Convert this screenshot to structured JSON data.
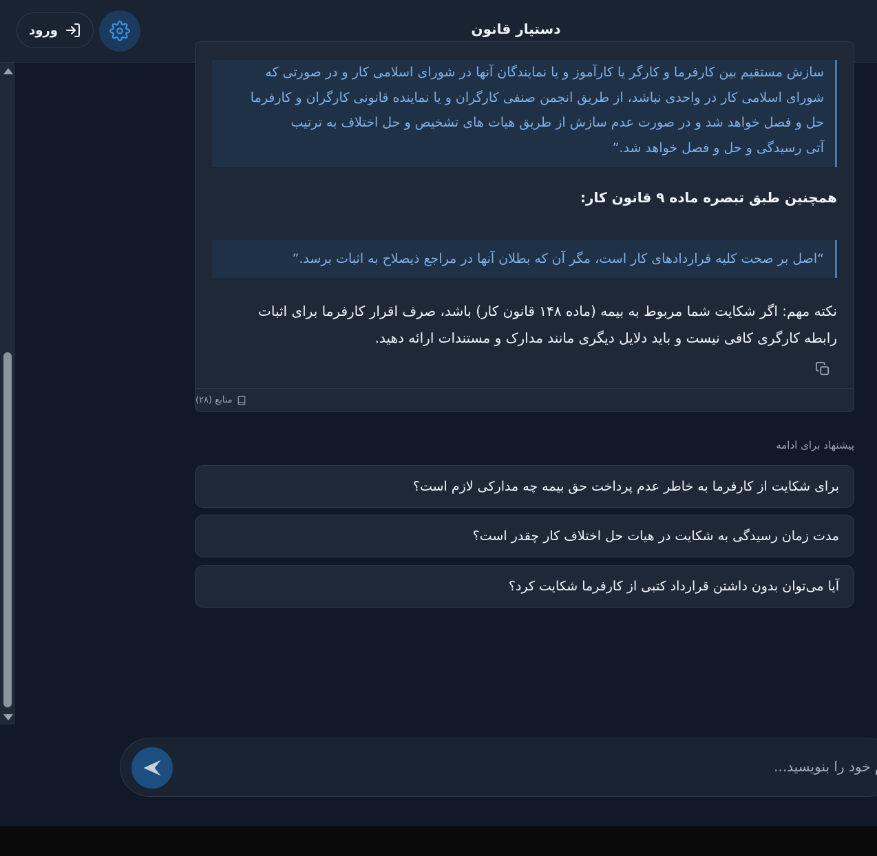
{
  "header": {
    "title": "دستیار قانون",
    "login_label": "ورود",
    "login_icon": "login-arrow-icon",
    "settings_icon": "gear-icon"
  },
  "message": {
    "quote1_lines": [
      "سازش مستقیم بین کارفرما و کارگر یا کارآموز و یا نمایندگان آنها در شورای اسلامی کار و در صورتی که",
      "شورای اسلامی کار در واحدی نباشد، از طریق انجمن صنفی کارگران و یا نماینده قانونی کارگران و کارفرما",
      "حل و فصل خواهد شد و در صورت عدم سازش از طریق هیات های تشخیص و حل اختلاف به ترتیب",
      "آتی رسیدگی و حل و فصل خواهد شد.”"
    ],
    "heading2": "همچنین طبق تبصره ماده ۹ قانون کار:",
    "quote2": "“اصل بر صحت کلیه قراردادهای کار است، مگر آن که بطلان آنها در مراجع ذیصلاح به اثبات برسد.”",
    "note_line1": "نکته مهم: اگر شکایت شما مربوط به بیمه (ماده ۱۴۸ قانون کار) باشد، صرف اقرار کارفرما برای اثبات",
    "note_line2": "رابطه کارگری کافی نیست و باید دلایل دیگری مانند مدارک و مستندات ارائه دهید.",
    "sources_label": "منابع (۲۸)"
  },
  "suggestions": {
    "label": "پیشنهاد برای ادامه",
    "items": [
      "برای شکایت از کارفرما به خاطر عدم پرداخت حق بیمه چه مدارکی لازم است؟",
      "مدت زمان رسیدگی به شکایت در هیات حل اختلاف کار چقدر است؟",
      "آیا می‌توان بدون داشتن قرارداد کتبی از کارفرما شکایت کرد؟"
    ]
  },
  "composer": {
    "placeholder": "پیام خود را بنویسید..."
  },
  "colors": {
    "background": "#111827",
    "card": "#1e2837",
    "quote_text": "#7fb0e6",
    "accent": "#1c4f80"
  }
}
